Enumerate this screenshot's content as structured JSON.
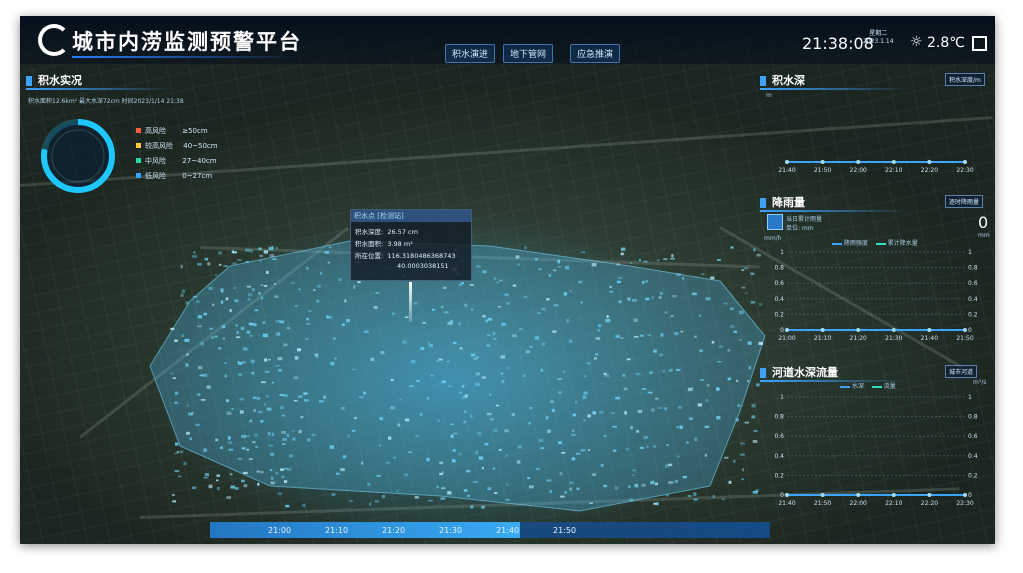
{
  "header": {
    "title": "城市内涝监测预警平台",
    "nav": [
      "积水演进",
      "地下管网",
      "应急推演"
    ],
    "time": "21:38:08",
    "weekday": "星期二",
    "date": "2023.1.14",
    "temperature": "2.8℃"
  },
  "waterlog_panel": {
    "title": "积水实况",
    "info_line": "积水面积12.6km² 最大水深72cm 时间2023/1/14 21:38",
    "legend": [
      {
        "label": "高风险",
        "value": "≥50cm",
        "color": "#ff5a3c"
      },
      {
        "label": "较高风险",
        "value": "40~50cm",
        "color": "#ffc83c"
      },
      {
        "label": "中风险",
        "value": "27~40cm",
        "color": "#2bd6a8"
      },
      {
        "label": "低风险",
        "value": "0~27cm",
        "color": "#2fa8ff"
      }
    ],
    "gauge_level": 0.78
  },
  "popup": {
    "title": "积水点 [检测站]",
    "depth_label": "积水深度:",
    "depth_value": "26.57 cm",
    "area_label": "积水面积:",
    "area_value": "3.98 m²",
    "loc_label": "所在位置:",
    "loc_value_1": "116.3180486368743",
    "loc_value_2": "40.0003038151"
  },
  "depth_panel": {
    "title": "积水深",
    "dropdown": "积水深度/m",
    "unit": "m",
    "x_ticks": [
      "21:40",
      "21:50",
      "22:00",
      "22:10",
      "22:20",
      "22:30"
    ]
  },
  "rain_panel": {
    "title": "降雨量",
    "dropdown": "逐时降雨量",
    "desc_1": "当日累计雨量",
    "desc_2": "单位: mm",
    "big_value": "0",
    "big_unit": "mm",
    "unit_left": "mm/h",
    "series": [
      "降雨强度",
      "累计降水量"
    ],
    "y_ticks": [
      "1",
      "0.8",
      "0.6",
      "0.4",
      "0.2",
      "0"
    ],
    "x_ticks": [
      "21:00",
      "21:10",
      "21:20",
      "21:30",
      "21:40",
      "21:50"
    ]
  },
  "river_panel": {
    "title": "河道水深流量",
    "dropdown": "城市河道",
    "unit_right": "m³/s",
    "series": [
      "水深",
      "流量"
    ],
    "y_ticks": [
      "1",
      "0.8",
      "0.6",
      "0.4",
      "0.2",
      "0"
    ],
    "x_ticks": [
      "21:40",
      "21:50",
      "22:00",
      "22:10",
      "22:20",
      "22:30"
    ]
  },
  "timeline": {
    "labels": [
      "21:00",
      "21:10",
      "21:20",
      "21:30",
      "21:40",
      "21:50"
    ]
  },
  "colors": {
    "accent": "#3ea2ff",
    "flood": "#5bd0ff",
    "gauge": "#1ec8ff"
  }
}
